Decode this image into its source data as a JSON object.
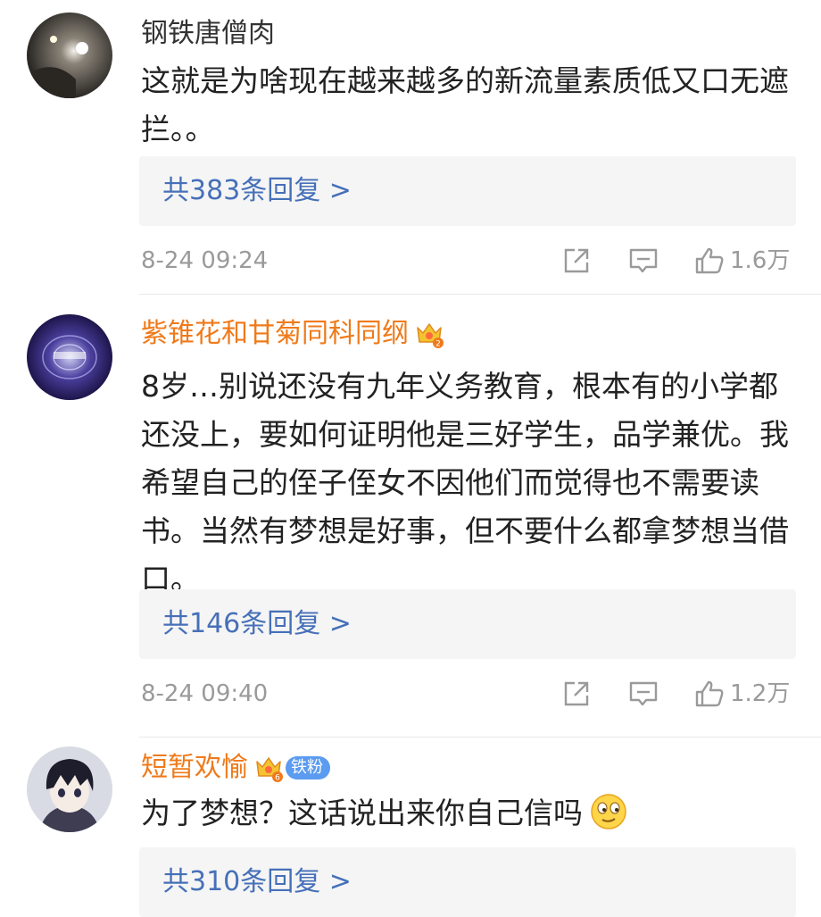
{
  "comments": [
    {
      "username": "钢铁唐僧肉",
      "text": "这就是为啥现在越来越多的新流量素质低又口无遮拦。。",
      "replies": "共383条回复 >",
      "time": "8-24 09:24",
      "likes": "1.6万",
      "avatar_icon": "night-photo-avatar",
      "name_color": "#333333"
    },
    {
      "username": "紫锥花和甘菊同科同纲",
      "text": "8岁…别说还没有九年义务教育，根本有的小学都还没上，要如何证明他是三好学生，品学兼优。我希望自己的侄子侄女不因他们而觉得也不需要读书。当然有梦想是好事，但不要什么都拿梦想当借口。",
      "replies": "共146条回复 >",
      "time": "8-24 09:40",
      "likes": "1.2万",
      "avatar_icon": "purple-galaxy-avatar",
      "badge_icon": "vip-crown-icon",
      "name_color": "#ef7a1a"
    },
    {
      "username": "短暂欢愉",
      "fan_badge": "铁粉",
      "text": "为了梦想？这话说出来你自己信吗",
      "replies": "共310条回复 >",
      "avatar_icon": "anime-boy-avatar",
      "badge_icon": "vip-crown-icon",
      "emoji_icon": "smirk-face-emoji",
      "name_color": "#ef7a1a"
    }
  ],
  "colors": {
    "reply_link": "#4670b8",
    "meta_gray": "#9a9a9a",
    "reply_bg": "#f5f5f5",
    "fan_badge_bg": "#5b9bf0"
  }
}
